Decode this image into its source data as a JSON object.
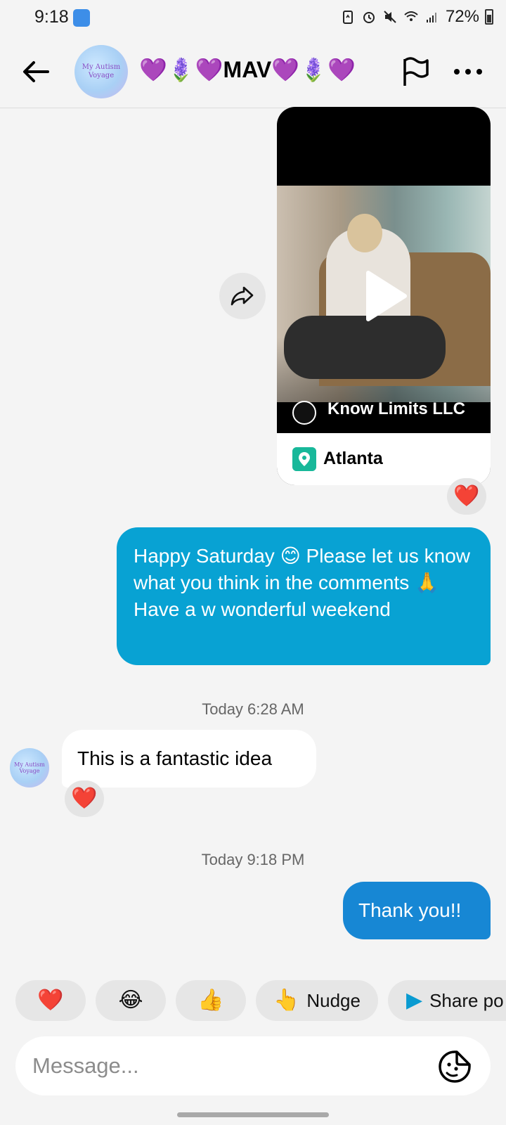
{
  "status_bar": {
    "time": "9:18",
    "battery": "72%",
    "icons": [
      "edit-app-icon",
      "battery-saver-icon",
      "alarm-icon",
      "mute-icon",
      "wifi-icon",
      "signal-icon",
      "battery-icon"
    ]
  },
  "header": {
    "back_icon": "arrow-left-icon",
    "avatar_text": "My Autism Voyage",
    "title": "💜🪻💜MAV💜🪻💜",
    "flag_icon": "flag-icon",
    "more_icon": "more-horizontal-icon"
  },
  "shared_video": {
    "creator": "Know Limits LLC",
    "location": "Atlanta",
    "play_icon": "play-icon",
    "location_icon": "map-pin-icon",
    "share_icon": "share-forward-icon",
    "reaction": "❤️"
  },
  "messages": [
    {
      "direction": "outgoing",
      "text": "Happy Saturday 😊 Please let us know what you think in the comments 🙏 Have a w wonderful weekend"
    },
    {
      "timestamp": "Today 6:28 AM"
    },
    {
      "direction": "incoming",
      "avatar_text": "My Autism Voyage",
      "text": "This is a fantastic idea",
      "reaction": "❤️"
    },
    {
      "timestamp": "Today 9:18 PM"
    },
    {
      "direction": "outgoing",
      "text": "Thank you!!"
    }
  ],
  "quick_replies": [
    {
      "emoji": "❤️",
      "label": ""
    },
    {
      "emoji": "😂",
      "label": ""
    },
    {
      "emoji": "👍",
      "label": ""
    },
    {
      "emoji": "👆",
      "label": "Nudge"
    },
    {
      "emoji": "▶",
      "label": "Share po"
    }
  ],
  "composer": {
    "placeholder": "Message...",
    "sticker_icon": "sticker-icon"
  },
  "colors": {
    "outgoing_bubble": "#08a2d3",
    "outgoing_bubble_2": "#1787d4",
    "incoming_bubble": "#ffffff",
    "background": "#f4f4f4",
    "location_pin": "#18b89a",
    "heart": "#e0102a"
  }
}
